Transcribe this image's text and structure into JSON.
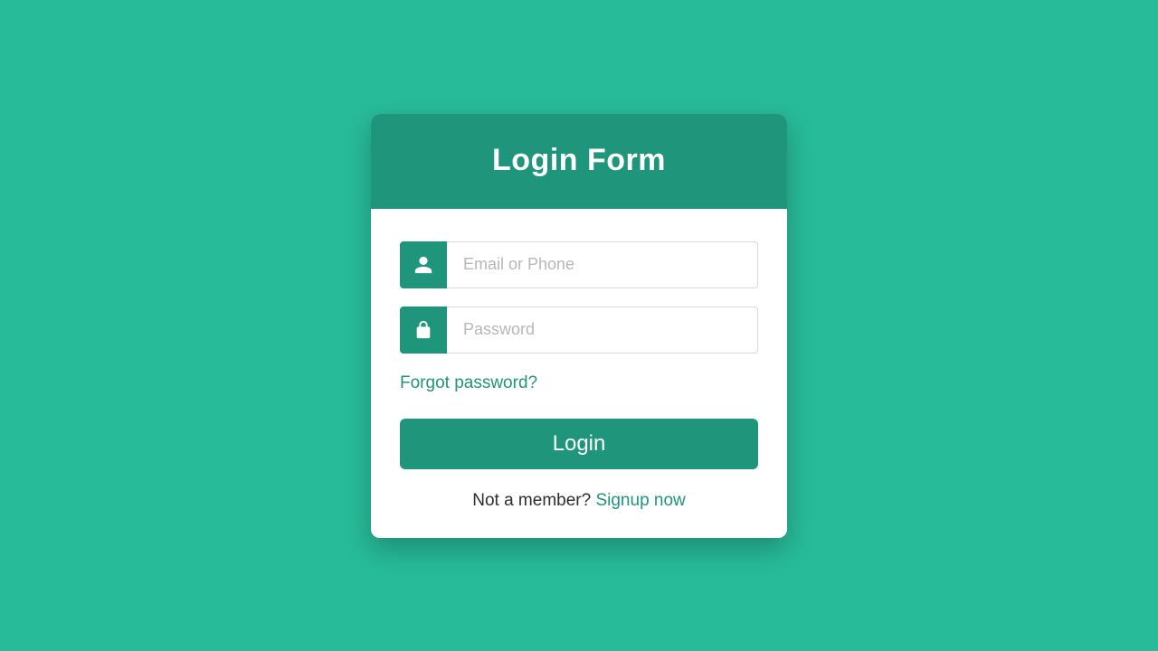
{
  "header": {
    "title": "Login Form"
  },
  "form": {
    "email": {
      "placeholder": "Email or Phone",
      "value": ""
    },
    "password": {
      "placeholder": "Password",
      "value": ""
    },
    "forgot_label": "Forgot password?",
    "login_label": "Login",
    "not_member_label": "Not a member? ",
    "signup_label": "Signup now"
  },
  "colors": {
    "background": "#27bb99",
    "accent": "#1f957b"
  }
}
